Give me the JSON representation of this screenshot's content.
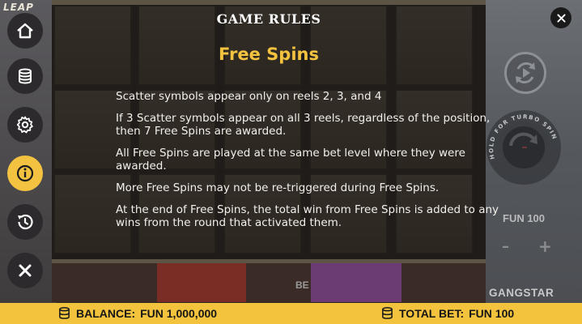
{
  "modal": {
    "title": "GAME RULES",
    "section_title": "Free Spins",
    "rules": [
      "Scatter symbols appear only on reels 2, 3, and 4",
      "If 3 Scatter symbols appear on all 3 reels, regardless of the position, then 7 Free Spins are awarded.",
      "All Free Spins are played at the same bet level where they were awarded.",
      "More Free Spins may not be re-triggered during Free Spins.",
      "At the end of Free Spins, the total win from Free Spins is added to any wins from the round that activated them."
    ]
  },
  "branding": {
    "top_left_logo": "LEAP",
    "game_logo": "GANGSTAR"
  },
  "reels": {
    "partial_text": "BE"
  },
  "sidebar": {
    "items": [
      {
        "icon": "home-icon"
      },
      {
        "icon": "coins-icon"
      },
      {
        "icon": "gear-icon"
      },
      {
        "icon": "info-icon",
        "active": true
      },
      {
        "icon": "history-icon"
      },
      {
        "icon": "close-icon"
      }
    ]
  },
  "controls": {
    "spin_hint": "HOLD FOR TURBO SPIN",
    "bet_display": "FUN 100",
    "minus": "–",
    "plus": "+"
  },
  "bottom_bar": {
    "balance_label": "BALANCE:",
    "balance_value": "FUN 1,000,000",
    "total_bet_label": "TOTAL BET:",
    "total_bet_value": "FUN 100"
  },
  "colors": {
    "accent": "#f3c241",
    "title_gold": "#f3c23f",
    "bar": "#f3c33d"
  }
}
